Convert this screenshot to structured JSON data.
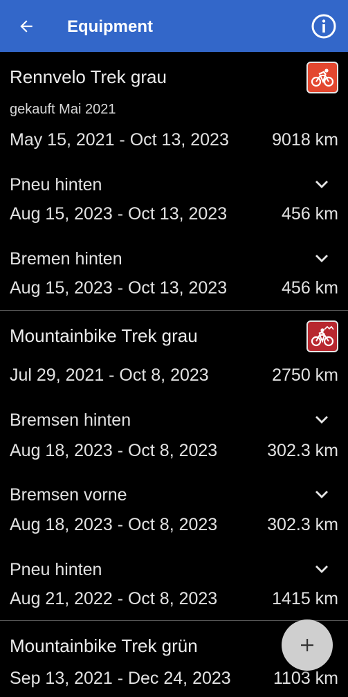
{
  "appbar": {
    "title": "Equipment",
    "back_icon": "arrow-left-icon",
    "info_icon": "info-circle-icon",
    "color": "#3367c9"
  },
  "bikes": [
    {
      "name": "Rennvelo Trek grau",
      "note": "gekauft Mai 2021",
      "range": "May 15, 2021 - Oct 13, 2023",
      "km": "9018 km",
      "icon": "road-bike-icon",
      "icon_color": "#e3472f",
      "parts": [
        {
          "name": "Pneu hinten",
          "range": "Aug 15, 2023 - Oct 13, 2023",
          "km": "456 km"
        },
        {
          "name": "Bremen hinten",
          "range": "Aug 15, 2023 - Oct 13, 2023",
          "km": "456 km"
        }
      ]
    },
    {
      "name": "Mountainbike Trek grau",
      "range": "Jul 29, 2021 - Oct 8, 2023",
      "km": "2750 km",
      "icon": "mountain-bike-icon",
      "icon_color": "#b8282f",
      "parts": [
        {
          "name": "Bremsen hinten",
          "range": "Aug 18, 2023 - Oct 8, 2023",
          "km": "302.3 km"
        },
        {
          "name": "Bremsen vorne",
          "range": "Aug 18, 2023 - Oct 8, 2023",
          "km": "302.3 km"
        },
        {
          "name": "Pneu hinten",
          "range": "Aug 21, 2022 - Oct 8, 2023",
          "km": "1415 km"
        }
      ]
    },
    {
      "name": "Mountainbike Trek grün",
      "range": "Sep 13, 2021 - Dec 24, 2023",
      "km": "1103 km"
    }
  ],
  "fab": {
    "icon": "plus-icon"
  }
}
